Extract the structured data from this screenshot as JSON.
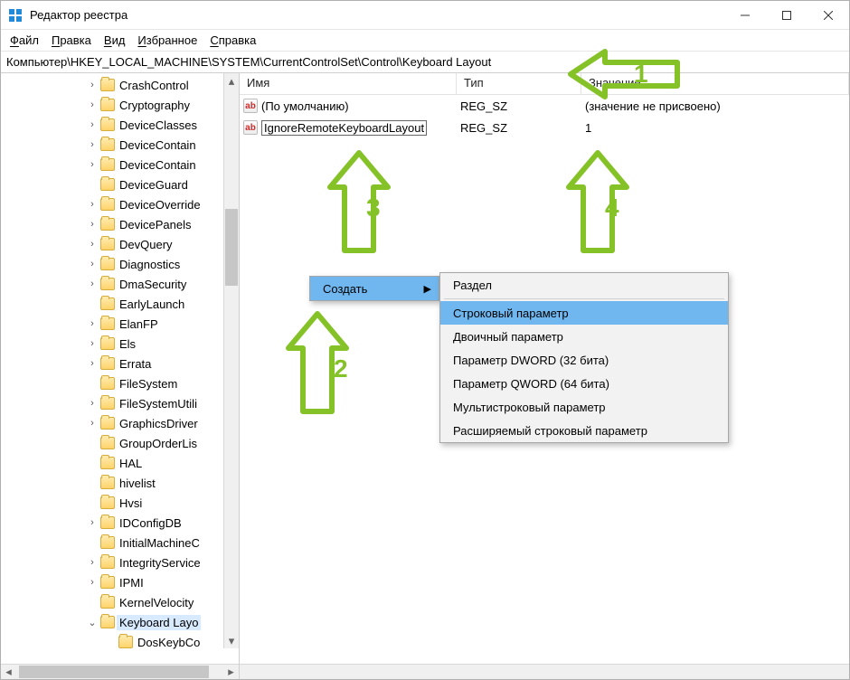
{
  "window": {
    "title": "Редактор реестра"
  },
  "menubar": {
    "file_u": "Ф",
    "file_r": "айл",
    "edit_u": "П",
    "edit_r": "равка",
    "view_u": "В",
    "view_r": "ид",
    "fav_u": "И",
    "fav_r": "збранное",
    "help_u": "С",
    "help_r": "правка"
  },
  "addressbar": {
    "path": "Компьютер\\HKEY_LOCAL_MACHINE\\SYSTEM\\CurrentControlSet\\Control\\Keyboard Layout"
  },
  "columns": {
    "name": "Имя",
    "type": "Тип",
    "value": "Значение"
  },
  "rows": {
    "default_name": "(По умолчанию)",
    "default_type": "REG_SZ",
    "default_value": "(значение не присвоено)",
    "editing_name": "IgnoreRemoteKeyboardLayout",
    "editing_type": "REG_SZ",
    "editing_value": "1"
  },
  "tree": {
    "items": [
      {
        "label": "CrashControl",
        "chev": ">"
      },
      {
        "label": "Cryptography",
        "chev": ">"
      },
      {
        "label": "DeviceClasses",
        "chev": ">"
      },
      {
        "label": "DeviceContain",
        "chev": ">"
      },
      {
        "label": "DeviceContain",
        "chev": ">"
      },
      {
        "label": "DeviceGuard",
        "chev": ""
      },
      {
        "label": "DeviceOverride",
        "chev": ">"
      },
      {
        "label": "DevicePanels",
        "chev": ">"
      },
      {
        "label": "DevQuery",
        "chev": ">"
      },
      {
        "label": "Diagnostics",
        "chev": ">"
      },
      {
        "label": "DmaSecurity",
        "chev": ">"
      },
      {
        "label": "EarlyLaunch",
        "chev": ""
      },
      {
        "label": "ElanFP",
        "chev": ">"
      },
      {
        "label": "Els",
        "chev": ">"
      },
      {
        "label": "Errata",
        "chev": ">"
      },
      {
        "label": "FileSystem",
        "chev": ""
      },
      {
        "label": "FileSystemUtili",
        "chev": ">"
      },
      {
        "label": "GraphicsDriver",
        "chev": ">"
      },
      {
        "label": "GroupOrderLis",
        "chev": ""
      },
      {
        "label": "HAL",
        "chev": ""
      },
      {
        "label": "hivelist",
        "chev": ""
      },
      {
        "label": "Hvsi",
        "chev": ""
      },
      {
        "label": "IDConfigDB",
        "chev": ">"
      },
      {
        "label": "InitialMachineC",
        "chev": ""
      },
      {
        "label": "IntegrityService",
        "chev": ">"
      },
      {
        "label": "IPMI",
        "chev": ">"
      },
      {
        "label": "KernelVelocity",
        "chev": ""
      },
      {
        "label": "Keyboard Layo",
        "chev": "v",
        "selected": true
      }
    ],
    "child": {
      "label": "DosKeybCo"
    }
  },
  "context_root": {
    "create": "Создать"
  },
  "context_sub": {
    "section": "Раздел",
    "string": "Строковый параметр",
    "binary": "Двоичный параметр",
    "dword": "Параметр DWORD (32 бита)",
    "qword": "Параметр QWORD (64 бита)",
    "multi": "Мультистроковый параметр",
    "expand": "Расширяемый строковый параметр"
  },
  "annot": {
    "n1": "1",
    "n2": "2",
    "n3": "3",
    "n4": "4"
  },
  "colors": {
    "accent_green": "#85c227",
    "menu_highlight": "#70b7f0"
  }
}
